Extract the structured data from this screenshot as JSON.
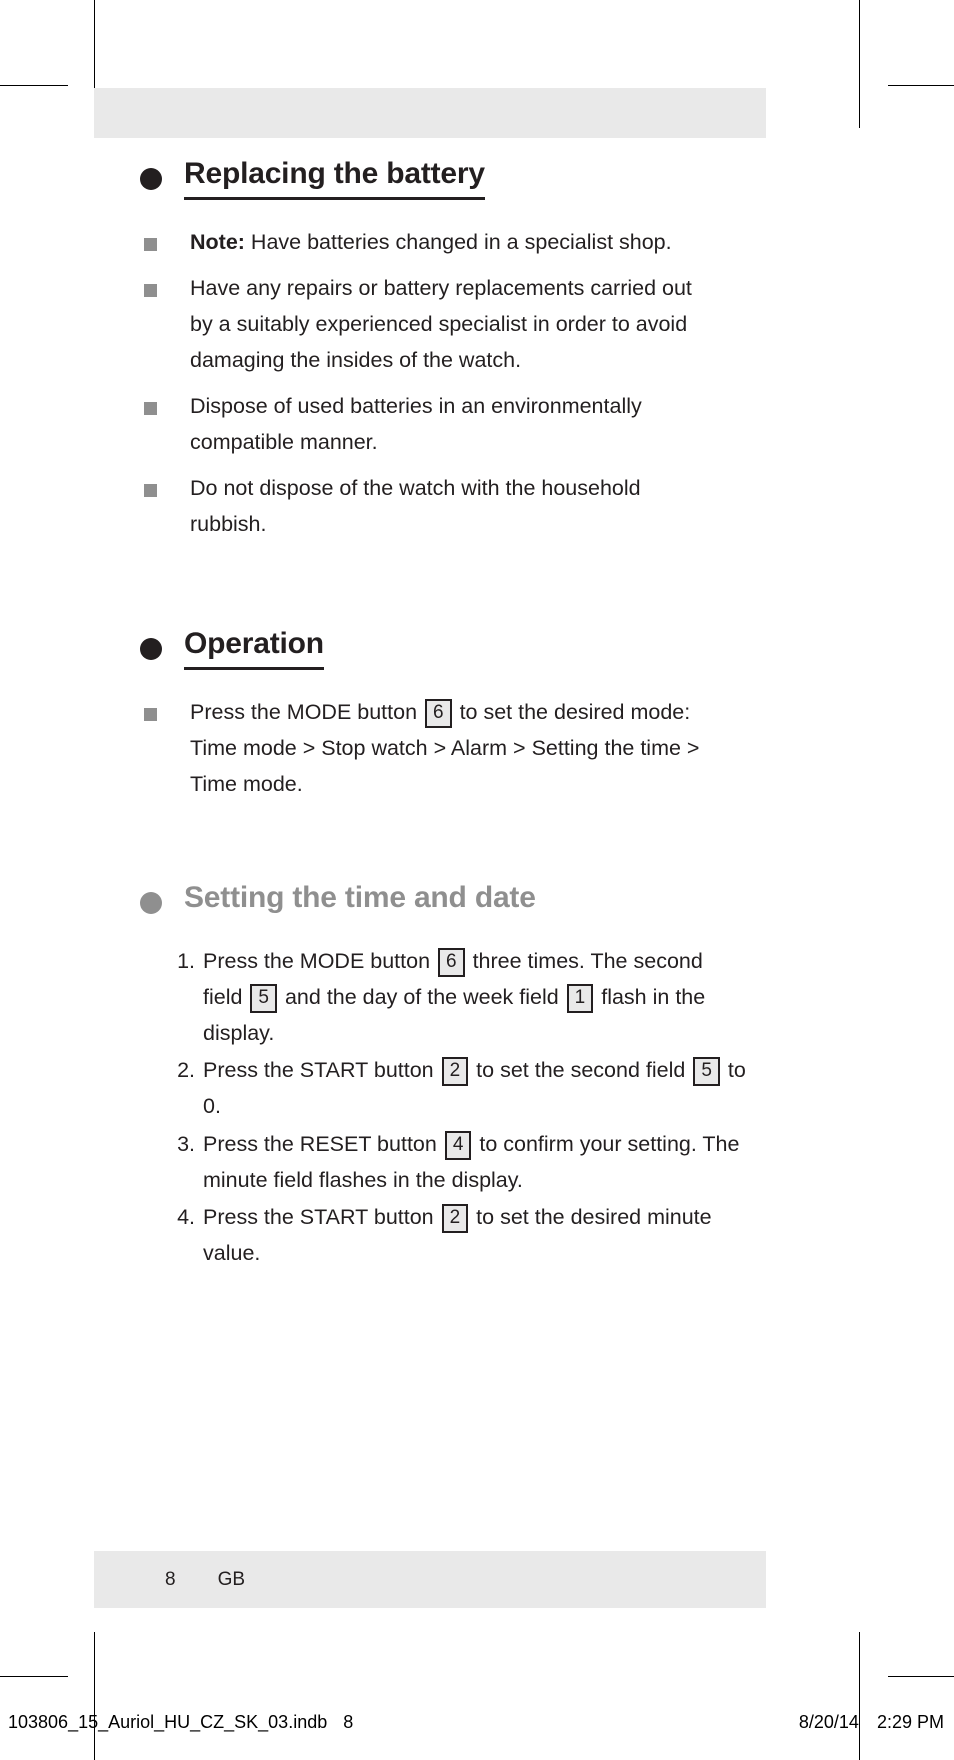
{
  "document": {
    "sections": [
      {
        "id": "replacing-the-battery",
        "heading": "Replacing the battery",
        "heading_style": "black-underlined",
        "bullets": [
          {
            "lead": "Note:",
            "text": " Have batteries changed in a specialist shop."
          },
          {
            "lead": "",
            "text": "Have any repairs or battery replacements carried out by a suitably experienced specialist in order to avoid damaging the insides of the watch."
          },
          {
            "lead": "",
            "text": "Dispose of used batteries in an environmentally compatible manner."
          },
          {
            "lead": "",
            "text": "Do not dispose of the watch with the household rubbish."
          }
        ]
      },
      {
        "id": "operation",
        "heading": "Operation ",
        "heading_style": "black-underlined",
        "bullets": [
          {
            "lead": "",
            "parts": [
              {
                "type": "text",
                "value": "Press the MODE button "
              },
              {
                "type": "ref",
                "value": "6"
              },
              {
                "type": "text",
                "value": " to set the desired mode: Time mode > Stop watch > Alarm > Setting the time > Time mode."
              }
            ]
          }
        ]
      },
      {
        "id": "setting-the-time-and-date",
        "heading": "Setting the time and date",
        "heading_style": "grey-plain",
        "steps": [
          {
            "index": "1.",
            "parts": [
              {
                "type": "text",
                "value": "Press the MODE button "
              },
              {
                "type": "ref",
                "value": "6"
              },
              {
                "type": "text",
                "value": " three times. The second field "
              },
              {
                "type": "ref",
                "value": "5"
              },
              {
                "type": "text",
                "value": " and the day of the week field "
              },
              {
                "type": "ref",
                "value": "1"
              },
              {
                "type": "text",
                "value": " flash in the display."
              }
            ]
          },
          {
            "index": "2.",
            "parts": [
              {
                "type": "text",
                "value": "Press the START button "
              },
              {
                "type": "ref",
                "value": "2"
              },
              {
                "type": "text",
                "value": " to set the second field "
              },
              {
                "type": "ref",
                "value": "5"
              },
              {
                "type": "text",
                "value": " to 0."
              }
            ]
          },
          {
            "index": "3.",
            "parts": [
              {
                "type": "text",
                "value": "Press the RESET button "
              },
              {
                "type": "ref",
                "value": "4"
              },
              {
                "type": "text",
                "value": " to confirm your setting. The minute field flashes in the display."
              }
            ]
          },
          {
            "index": "4.",
            "parts": [
              {
                "type": "text",
                "value": "Press the START button "
              },
              {
                "type": "ref",
                "value": "2"
              },
              {
                "type": "text",
                "value": " to set the desired minute value."
              }
            ]
          }
        ]
      }
    ]
  },
  "footer": {
    "page_number": "8",
    "language_code": "GB"
  },
  "print_slug": {
    "filename": "103806_15_Auriol_HU_CZ_SK_03.indb",
    "page": "8",
    "date": "8/20/14",
    "time": "2:29 PM"
  },
  "colors": {
    "band": "#e9e9e9",
    "text": "#231f20",
    "grey_heading": "#8f8f8f",
    "square_bullet": "#8f8f8f",
    "ref_fill": "#e9e9e9"
  }
}
